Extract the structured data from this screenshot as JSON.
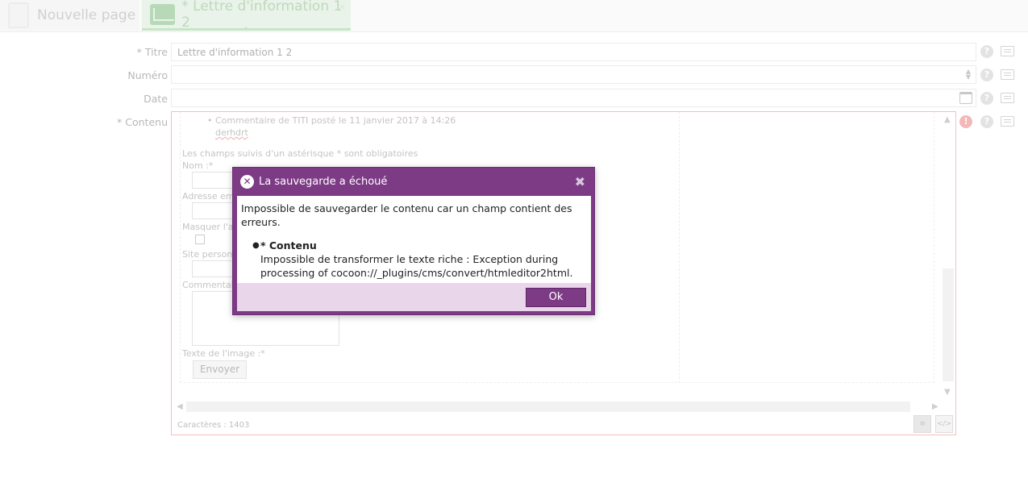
{
  "tabs": [
    {
      "label": "Nouvelle page",
      "icon": "page-icon"
    },
    {
      "label": "* Lettre d'information 1 2",
      "icon": "newsletter-icon",
      "close": "×"
    }
  ],
  "form": {
    "title_label": "* Titre",
    "title_value": "Lettre d'information 1 2",
    "numero_label": "Numéro",
    "numero_value": "",
    "date_label": "Date",
    "date_value": "",
    "content_label": "* Contenu"
  },
  "editor": {
    "comment_line": "Commentaire de TITI posté le 11 janvier 2017 à 14:26",
    "comment_author": "derhdrt",
    "required_note": "Les champs suivis d'un astérisque * sont obligatoires",
    "nom_label": "Nom :*",
    "email_label": "Adresse ema",
    "masquer_label": "Masquer l'adr",
    "site_label": "Site personne",
    "commentaire_label": "Commentaire",
    "image_label": "Texte de l'image :*",
    "send_button": "Envoyer",
    "char_count": "Caractères : 1403",
    "wysiwyg_mode": "≡",
    "source_mode": "</>"
  },
  "dialog": {
    "title": "La sauvegarde a échoué",
    "close": "✖",
    "message": "Impossible de sauvegarder le contenu car un champ contient des erreurs.",
    "error_field": "* Contenu",
    "error_detail": "Impossible de transformer le texte riche : Exception during processing of cocoon://_plugins/cms/convert/htmleditor2html.",
    "ok_button": "Ok"
  },
  "colors": {
    "dialog_header": "#7d3b86",
    "dialog_footer": "#ead6ea",
    "error_border": "#f4c0c0",
    "active_tab": "#eaf3ea"
  }
}
